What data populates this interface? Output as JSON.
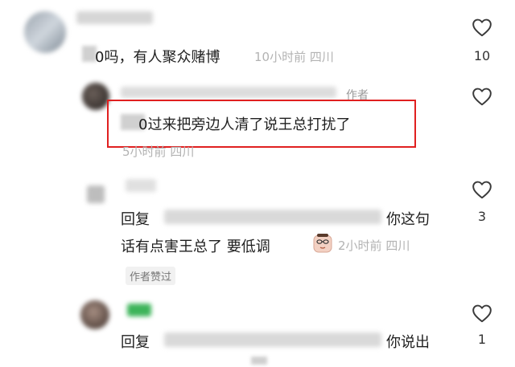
{
  "comments": [
    {
      "text_visible": "0吗，有人聚众赌博",
      "time": "10小时前",
      "location": "四川",
      "like_count": "10"
    },
    {
      "author_tag": "作者",
      "text_visible": "0过来把旁边人清了说王总打扰了",
      "time": "5小时前",
      "location": "四川"
    },
    {
      "reply_prefix": "回复",
      "reply_tail": "你这句",
      "text_line2": "话有点害王总了  要低调",
      "time": "2小时前",
      "location": "四川",
      "like_count": "3",
      "author_liked_tag": "作者赞过"
    },
    {
      "reply_prefix": "回复",
      "reply_tail": "你说出",
      "like_count": "1"
    }
  ],
  "icons": {
    "like": "heart-outline-icon",
    "emoji": "sticker-emoji-icon"
  },
  "colors": {
    "highlight_box": "#e02020",
    "meta_text": "#b3b3b3"
  }
}
